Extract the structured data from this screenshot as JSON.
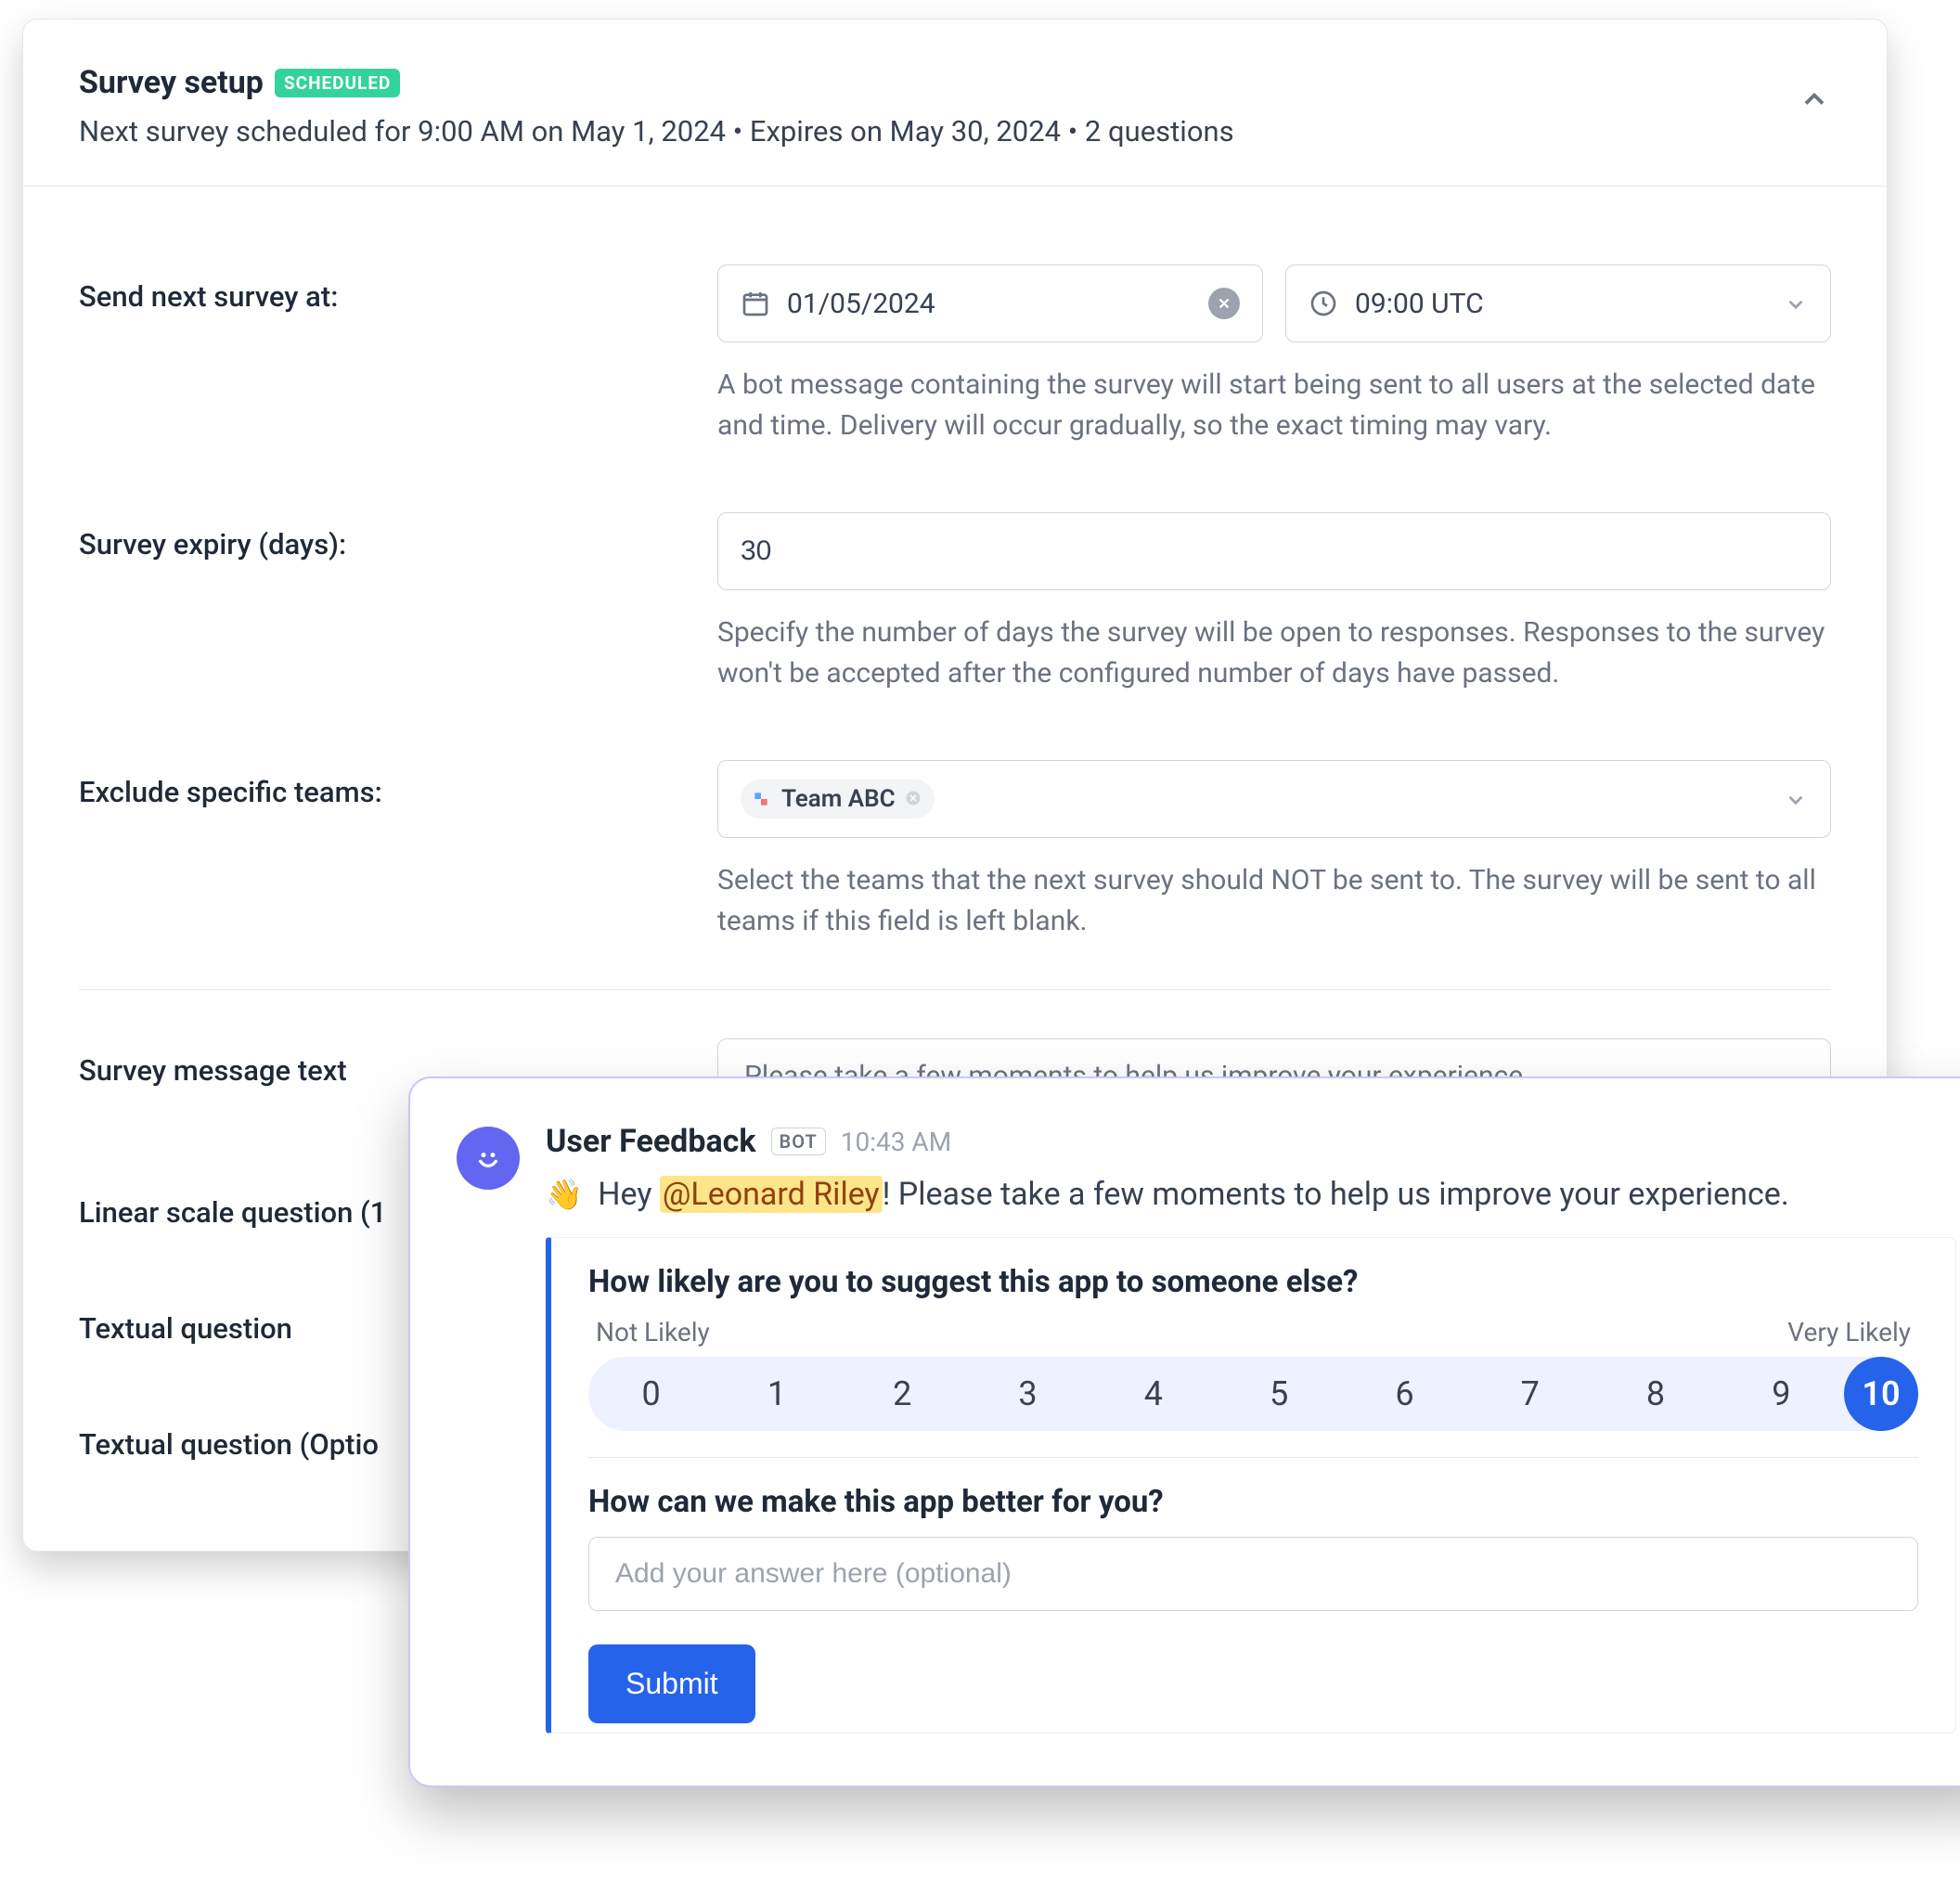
{
  "header": {
    "title": "Survey setup",
    "badge": "SCHEDULED",
    "subtitle": "Next survey scheduled for 9:00 AM on May 1, 2024 • Expires on May 30, 2024 • 2 questions"
  },
  "form": {
    "send_at": {
      "label": "Send next survey at:",
      "date_value": "01/05/2024",
      "time_value": "09:00 UTC",
      "helper": "A bot message containing the survey will start being sent to all users at the selected date and time. Delivery will occur gradually, so the exact timing may vary."
    },
    "expiry": {
      "label": "Survey expiry (days):",
      "value": "30",
      "helper": "Specify the number of days the survey will be open to responses. Responses to the survey won't be accepted after the configured number of days have passed."
    },
    "exclude": {
      "label": "Exclude specific teams:",
      "chip": "Team ABC",
      "helper": "Select the teams that the next survey should NOT be sent to. The survey will be sent to all teams if this field is left blank."
    },
    "message_text": {
      "label": "Survey message text",
      "placeholder": "Please take a few moments to help us improve your experience."
    },
    "linear_q": {
      "label": "Linear scale question (1"
    },
    "textual_q": {
      "label": "Textual question"
    },
    "textual_opt_q": {
      "label": "Textual question (Optio"
    }
  },
  "chat": {
    "name": "User Feedback",
    "bot_badge": "BOT",
    "time": "10:43 AM",
    "wave": "👋",
    "greeting_prefix": " Hey ",
    "mention": "@Leonard Riley",
    "greeting_suffix": "! Please take a few moments to help us improve your experience.",
    "q1_title": "How likely are you to suggest this app to someone else?",
    "scale_low": "Not Likely",
    "scale_high": "Very Likely",
    "scale_values": [
      "0",
      "1",
      "2",
      "3",
      "4",
      "5",
      "6",
      "7",
      "8",
      "9",
      "10"
    ],
    "scale_selected": "10",
    "q2_title": "How can we make this app better for you?",
    "q2_placeholder": "Add your answer here (optional)",
    "submit": "Submit"
  }
}
